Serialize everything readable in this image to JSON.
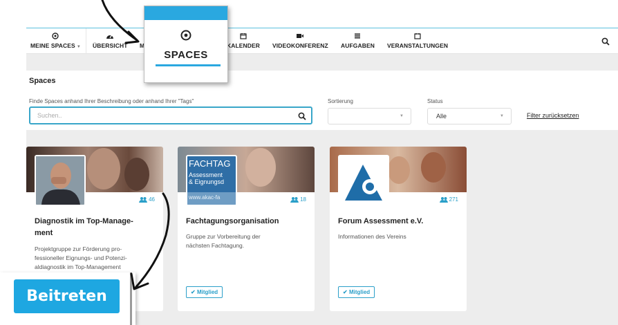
{
  "nav": {
    "items": [
      {
        "label": "MEINE SPACES",
        "icon": "target-icon"
      },
      {
        "label": "ÜBERSICHT",
        "icon": "dashboard-icon"
      },
      {
        "label": "M",
        "icon": ""
      },
      {
        "label": "KALENDER",
        "icon": "calendar-icon"
      },
      {
        "label": "VIDEOKONFERENZ",
        "icon": "video-icon"
      },
      {
        "label": "AUFGABEN",
        "icon": "list-icon"
      },
      {
        "label": "VERANSTALTUNGEN",
        "icon": "calendar-icon"
      }
    ]
  },
  "zoom_callout": {
    "label": "SPACES"
  },
  "spaces": {
    "title": "Spaces",
    "search_label": "Finde Spaces anhand Ihrer Beschreibung oder anhand Ihrer \"Tags\"",
    "search_placeholder": "Suchen..",
    "sort_label": "Sortierung",
    "sort_value": "",
    "status_label": "Status",
    "status_value": "Alle",
    "reset_label": "Filter zurücksetzen"
  },
  "cards": [
    {
      "title": "Diagnostik im Top-Manage-ment",
      "title_line1": "Diagnostik im Top-Manage-",
      "title_line2": "ment",
      "members": "46",
      "desc_lines": [
        "Projektgruppe zur Förderung pro-",
        "fessioneller Eignungs- und Potenzi-",
        "aldiagnostik im Top-Management"
      ]
    },
    {
      "title": "Fachtagungsorganisation",
      "members": "18",
      "logo_lines": [
        "FACHTAG",
        "Assessment",
        "& Eignungsd",
        "www.akac-fa"
      ],
      "desc_lines": [
        "Gruppe zur Vorbereitung der",
        "nächsten Fachtagung."
      ],
      "badge": "Mitglied"
    },
    {
      "title": "Forum Assessment e.V.",
      "members": "271",
      "desc_lines": [
        "Informationen des Vereins"
      ],
      "badge": "Mitglied"
    }
  ],
  "join_button": {
    "label": "Beitreten"
  },
  "colors": {
    "accent": "#2aa8e0",
    "panel_bg": "#ededed",
    "text": "#222222"
  }
}
